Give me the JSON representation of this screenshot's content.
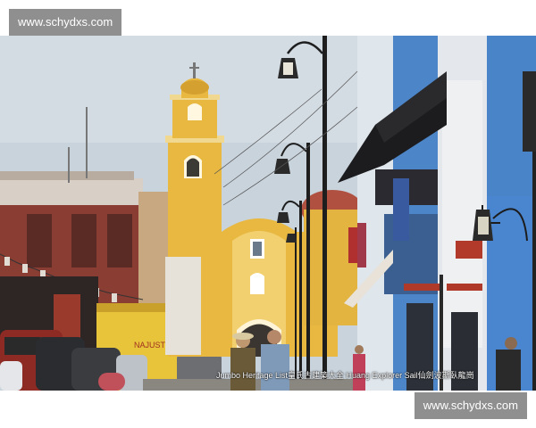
{
  "watermark_top": "www.schydxs.com",
  "watermark_bottom": "www.schydxs.com",
  "caption": "Jumbo Heritage List皇氏古建築大全 Huang Explorer Sail仙劍波斯臥龍崗",
  "scene": {
    "sky_color": "#c9d3dc",
    "church_color": "#e8b840",
    "blue_building_color": "#4d86c8",
    "red_building_color": "#8a3d33"
  }
}
